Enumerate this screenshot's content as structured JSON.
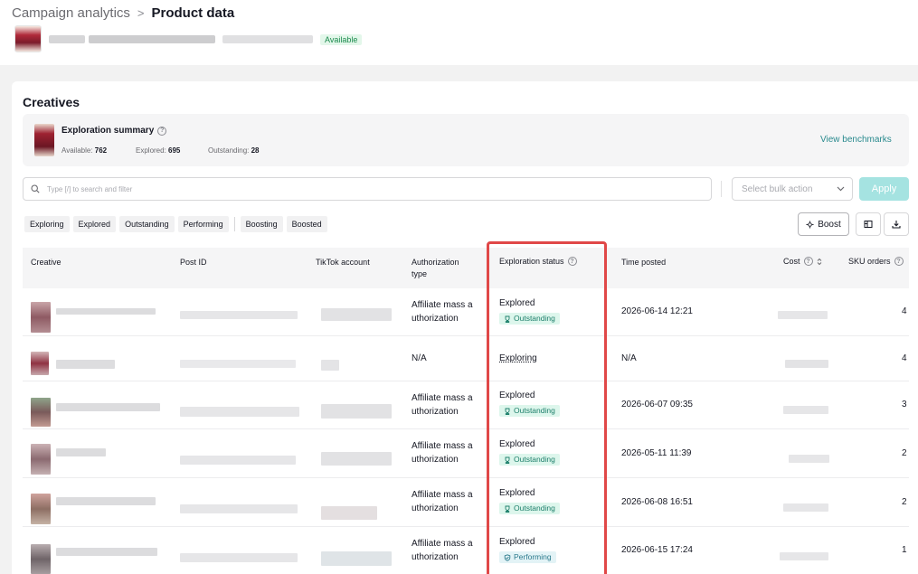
{
  "header": {
    "breadcrumb_parent": "Campaign analytics",
    "breadcrumb_sep": ">",
    "breadcrumb_current": "Product data",
    "product_status": "Available"
  },
  "section": {
    "title": "Creatives"
  },
  "summary": {
    "title": "Exploration summary",
    "available_label": "Available:",
    "available_value": "762",
    "explored_label": "Explored:",
    "explored_value": "695",
    "outstanding_label": "Outstanding:",
    "outstanding_value": "28",
    "view_benchmarks": "View benchmarks"
  },
  "toolbar": {
    "search_placeholder": "Type [/] to search and filter",
    "bulk_placeholder": "Select bulk action",
    "apply_label": "Apply",
    "boost_label": "Boost"
  },
  "filters": {
    "status": [
      "Exploring",
      "Explored",
      "Outstanding",
      "Performing"
    ],
    "boost": [
      "Boosting",
      "Boosted"
    ]
  },
  "table": {
    "columns": {
      "creative": "Creative",
      "post_id": "Post ID",
      "account": "TikTok account",
      "auth_line1": "Authorization",
      "auth_line2": "type",
      "status": "Exploration status",
      "time": "Time posted",
      "cost": "Cost",
      "sku": "SKU orders"
    },
    "rows": [
      {
        "auth1": "Affiliate mass a",
        "auth2": "uthorization",
        "status": "Explored",
        "tag": "Outstanding",
        "time": "2026-06-14 12:21",
        "sku": "4"
      },
      {
        "auth1": "N/A",
        "auth2": "",
        "status": "Exploring",
        "tag": "",
        "time": "N/A",
        "sku": "4"
      },
      {
        "auth1": "Affiliate mass a",
        "auth2": "uthorization",
        "status": "Explored",
        "tag": "Outstanding",
        "time": "2026-06-07 09:35",
        "sku": "3"
      },
      {
        "auth1": "Affiliate mass a",
        "auth2": "uthorization",
        "status": "Explored",
        "tag": "Outstanding",
        "time": "2026-05-11 11:39",
        "sku": "2"
      },
      {
        "auth1": "Affiliate mass a",
        "auth2": "uthorization",
        "status": "Explored",
        "tag": "Outstanding",
        "time": "2026-06-08 16:51",
        "sku": "2"
      },
      {
        "auth1": "Affiliate mass a",
        "auth2": "uthorization",
        "status": "Explored",
        "tag": "Performing",
        "time": "2026-06-15 17:24",
        "sku": "1"
      }
    ]
  },
  "colors": {
    "accent": "#2a8a8e",
    "highlight": "#e04848",
    "tag_bg": "#ddf6ec",
    "tag_text": "#1d7f6b"
  }
}
